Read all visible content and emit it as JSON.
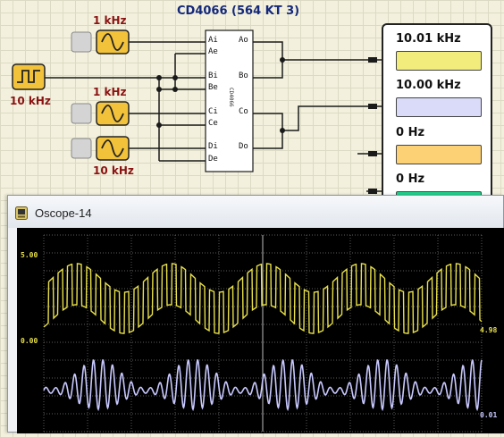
{
  "circuit": {
    "title": "CD4066 (564 KT 3)",
    "chip": {
      "name": "CD4066",
      "pins_left": [
        "Ai",
        "Ae",
        "Bi",
        "Be",
        "Ci",
        "Ce",
        "Di",
        "De"
      ],
      "pins_right": [
        "Ao",
        "Bo",
        "Co",
        "Do"
      ]
    },
    "generators": [
      {
        "freq_label": "1 kHz"
      },
      {
        "freq_label": "1 kHz"
      },
      {
        "freq_label": "10 kHz"
      }
    ],
    "clock": {
      "freq_label": "10 kHz"
    }
  },
  "meters": [
    {
      "value": "10.01 kHz",
      "color": "#f1ec7c"
    },
    {
      "value": "10.00 kHz",
      "color": "#d9dbf9"
    },
    {
      "value": "0 Hz",
      "color": "#fcd074"
    },
    {
      "value": "0 Hz",
      "color": "#19d68c"
    }
  ],
  "oscilloscope": {
    "title": "Oscope-14",
    "ch1": {
      "top_label": "5.00",
      "bottom_label": "0.00",
      "reading": "4.98",
      "color": "#e8e04a"
    },
    "ch2": {
      "reading": "0.01",
      "color": "#c8c8ff"
    }
  }
}
